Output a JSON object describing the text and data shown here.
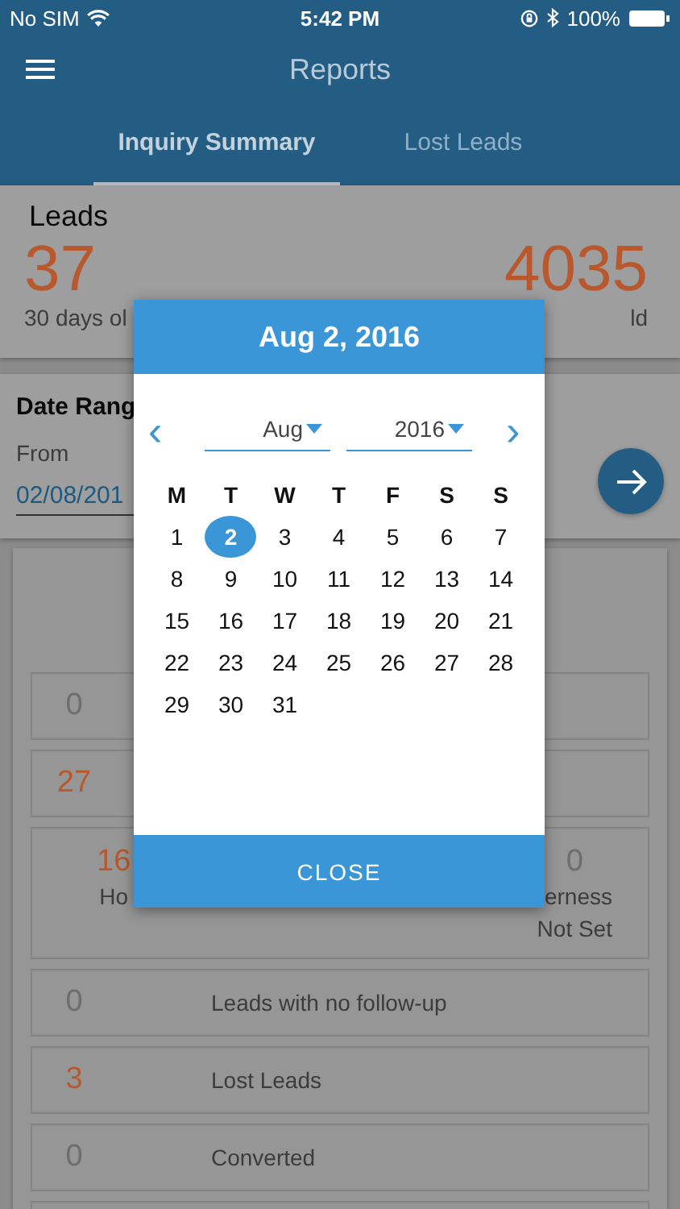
{
  "status_bar": {
    "carrier": "No SIM",
    "time": "5:42 PM",
    "battery": "100%"
  },
  "header": {
    "title": "Reports"
  },
  "tabs": [
    {
      "label": "Inquiry Summary",
      "selected": true
    },
    {
      "label": "Lost Leads",
      "selected": false
    }
  ],
  "leads_card": {
    "title": "Leads",
    "stats": [
      {
        "value": "37",
        "label": "30 days ol"
      },
      {
        "value": "4035",
        "label": "ld"
      }
    ]
  },
  "date_range": {
    "title": "Date Rang",
    "from_label": "From",
    "from_value": "02/08/201"
  },
  "summary_rows": [
    {
      "kind": "single",
      "value": "0",
      "color": "#6e6e6e"
    },
    {
      "kind": "single",
      "value": "27",
      "color": "#b8582c"
    },
    {
      "kind": "split",
      "cells": [
        {
          "value": "16",
          "color": "#b8582c",
          "label": "Ho"
        },
        {
          "value": "0",
          "color": "#6e6e6e",
          "label": "erness",
          "label_2": "Not Set"
        }
      ]
    },
    {
      "kind": "single",
      "value": "0",
      "color": "#6e6e6e",
      "label": "Leads with no follow-up"
    },
    {
      "kind": "single",
      "value": "3",
      "color": "#b8582c",
      "label": "Lost Leads"
    },
    {
      "kind": "single",
      "value": "0",
      "color": "#6e6e6e",
      "label": "Converted"
    },
    {
      "kind": "empty"
    }
  ],
  "date_picker": {
    "title": "Aug 2, 2016",
    "month": "Aug",
    "year": "2016",
    "prev": "‹",
    "next": "›",
    "weekdays": [
      "M",
      "T",
      "W",
      "T",
      "F",
      "S",
      "S"
    ],
    "days": [
      {
        "label": "1",
        "selected": false
      },
      {
        "label": "2",
        "selected": true
      },
      {
        "label": "3",
        "selected": false
      },
      {
        "label": "4",
        "selected": false
      },
      {
        "label": "5",
        "selected": false
      },
      {
        "label": "6",
        "selected": false
      },
      {
        "label": "7",
        "selected": false
      },
      {
        "label": "8",
        "selected": false
      },
      {
        "label": "9",
        "selected": false
      },
      {
        "label": "10",
        "selected": false
      },
      {
        "label": "11",
        "selected": false
      },
      {
        "label": "12",
        "selected": false
      },
      {
        "label": "13",
        "selected": false
      },
      {
        "label": "14",
        "selected": false
      },
      {
        "label": "15",
        "selected": false
      },
      {
        "label": "16",
        "selected": false
      },
      {
        "label": "17",
        "selected": false
      },
      {
        "label": "18",
        "selected": false
      },
      {
        "label": "19",
        "selected": false
      },
      {
        "label": "20",
        "selected": false
      },
      {
        "label": "21",
        "selected": false
      },
      {
        "label": "22",
        "selected": false
      },
      {
        "label": "23",
        "selected": false
      },
      {
        "label": "24",
        "selected": false
      },
      {
        "label": "25",
        "selected": false
      },
      {
        "label": "26",
        "selected": false
      },
      {
        "label": "27",
        "selected": false
      },
      {
        "label": "28",
        "selected": false
      },
      {
        "label": "29",
        "selected": false
      },
      {
        "label": "30",
        "selected": false
      },
      {
        "label": "31",
        "selected": false
      }
    ],
    "close": "CLOSE"
  }
}
